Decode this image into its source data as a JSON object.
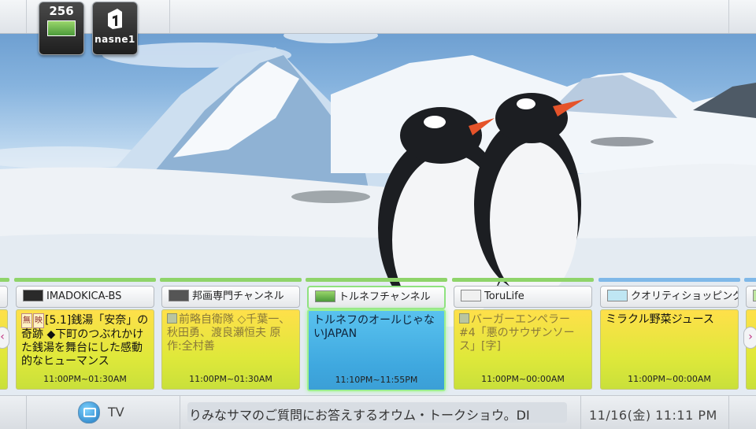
{
  "top_tiles": [
    {
      "number": "256",
      "logo": "channel-logo"
    },
    {
      "label": "nasne1",
      "logo": "nasne-logo"
    }
  ],
  "channels": [
    {
      "name": "IMADOKICA-BS",
      "program_parts": [
        {
          "tag": "無",
          "text": ""
        },
        {
          "tag": "映",
          "text": "[5.1]銭湯「安奈」の奇跡 ◆下町のつぶれかけた銭湯を舞台にした感動的なヒューマンス"
        }
      ],
      "time": "11:00PM~01:30AM",
      "state": "normal",
      "bar_color": "#8fd46a"
    },
    {
      "name": "邦画専門チャンネル",
      "program_parts": [
        {
          "tag": "",
          "text": "前略自衛隊 ◇千葉一、秋田勇、渡良瀬恒夫 原作:全村善"
        }
      ],
      "time": "11:00PM~01:30AM",
      "state": "dim",
      "bar_color": "#8fd46a"
    },
    {
      "name": "トルネフチャンネル",
      "program_parts": [
        {
          "tag": "",
          "text": "トルネフのオールじゃないJAPAN"
        }
      ],
      "time": "11:10PM~11:55PM",
      "state": "selected",
      "bar_color": "#8fd46a"
    },
    {
      "name": "ToruLife",
      "program_parts": [
        {
          "tag": "",
          "text": "バーガーエンペラー #4「悪のサウザンソース」[字]"
        }
      ],
      "time": "11:00PM~00:00AM",
      "state": "dim",
      "bar_color": "#8fd46a"
    },
    {
      "name": "クオリティショッピング",
      "program_parts": [
        {
          "tag": "",
          "text": "ミラクル野菜ジュース"
        }
      ],
      "time": "11:00PM~00:00AM",
      "state": "normal",
      "bar_color": "#7fb8e8"
    }
  ],
  "bottom": {
    "source_label": "TV",
    "ticker": "りみなサマのご質問にお答えするオウム・トークショウ。DI",
    "clock": "11/16(金) 11:11 PM"
  },
  "colors": {
    "accent_green": "#8fe27f",
    "selected_blue": "#4ab3e6",
    "program_yellow": "#e8e63c"
  }
}
